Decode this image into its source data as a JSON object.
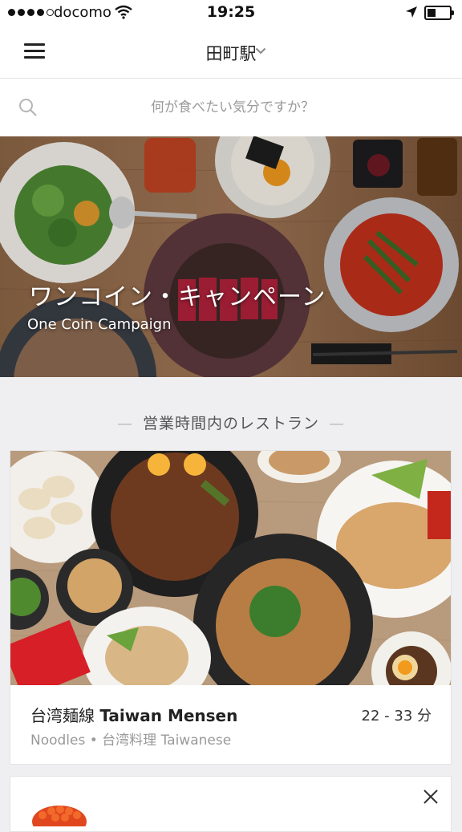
{
  "status_bar": {
    "carrier": "docomo",
    "time": "19:25"
  },
  "nav": {
    "location": "田町駅"
  },
  "search": {
    "placeholder": "何が食べたい気分ですか？"
  },
  "hero": {
    "title": "ワンコイン・キャンペーン",
    "subtitle": "One Coin Campaign"
  },
  "section": {
    "title": "営業時間内のレストラン"
  },
  "restaurants": [
    {
      "name_jp": "台湾麺線",
      "name_en": "Taiwan Mensen",
      "time": "22 - 33 分",
      "category": "Noodles • 台湾料理 Taiwanese"
    }
  ],
  "icons": {
    "menu": "menu-icon",
    "search": "search-icon",
    "chevron": "chevron-down-icon",
    "close": "close-icon",
    "wifi": "wifi-icon",
    "location": "location-arrow-icon",
    "battery": "battery-icon"
  },
  "colors": {
    "background": "#efeff2",
    "text": "#222222",
    "secondary_text": "#999999"
  }
}
